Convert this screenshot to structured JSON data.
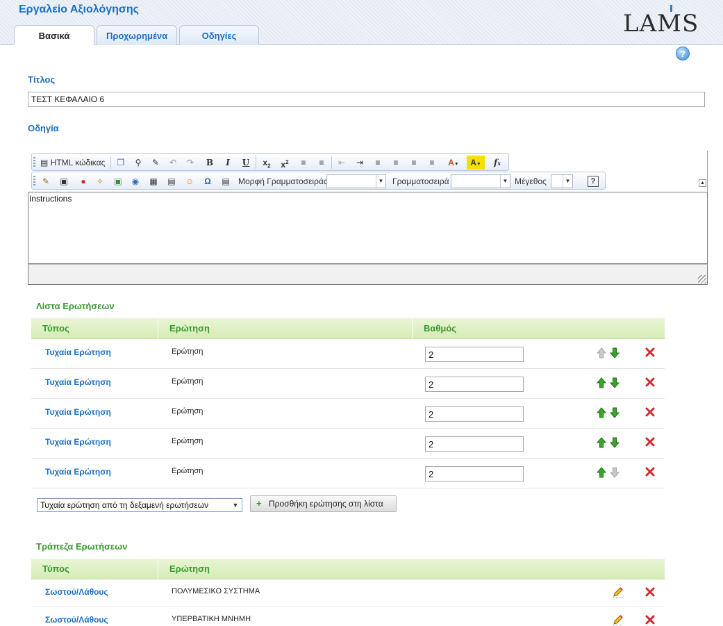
{
  "app": {
    "title": "Εργαλείο Αξιολόγησης",
    "logo": "LAMS"
  },
  "tabs": [
    {
      "label": "Βασικά",
      "active": true
    },
    {
      "label": "Προχωρημένα",
      "active": false
    },
    {
      "label": "Οδηγίες",
      "active": false
    }
  ],
  "help_icon": "?",
  "form": {
    "title_label": "Τίτλος",
    "title_value": "ΤΕΣΤ ΚΕΦΑΛΑΙΟ 6",
    "instructions_label": "Οδηγία",
    "instructions_value": "Instructions"
  },
  "editor_toolbar": {
    "html_source": "HTML κώδικας",
    "format_label": "Μορφή Γραμματοσειράς",
    "font_label": "Γραμματοσειρά",
    "size_label": "Μέγεθος",
    "help": "?"
  },
  "question_list": {
    "heading": "Λίστα Ερωτήσεων",
    "columns": [
      "Τύπος",
      "Ερώτηση",
      "Βαθμός"
    ],
    "rows": [
      {
        "type": "Τυχαία Ερώτηση",
        "question": "Ερώτηση",
        "grade": "2",
        "up_enabled": false,
        "down_enabled": true
      },
      {
        "type": "Τυχαία Ερώτηση",
        "question": "Ερώτηση",
        "grade": "2",
        "up_enabled": true,
        "down_enabled": true
      },
      {
        "type": "Τυχαία Ερώτηση",
        "question": "Ερώτηση",
        "grade": "2",
        "up_enabled": true,
        "down_enabled": true
      },
      {
        "type": "Τυχαία Ερώτηση",
        "question": "Ερώτηση",
        "grade": "2",
        "up_enabled": true,
        "down_enabled": true
      },
      {
        "type": "Τυχαία Ερώτηση",
        "question": "Ερώτηση",
        "grade": "2",
        "up_enabled": true,
        "down_enabled": false
      }
    ],
    "selector_value": "Τυχαία ερώτηση από τη δεξαμενή ερωτήσεων",
    "add_button": "Προσθήκη ερώτησης στη λίστα"
  },
  "question_bank": {
    "heading": "Τράπεζα Ερωτήσεων",
    "columns": [
      "Τύπος",
      "Ερώτηση"
    ],
    "rows": [
      {
        "type": "Σωστού/Λάθους",
        "question": "ΠΟΛΥΜΕΣΙΚΟ ΣΥΣΤΗΜΑ"
      },
      {
        "type": "Σωστού/Λάθους",
        "question": "ΥΠΕΡΒΑΤΙΚΗ ΜΝΗΜΗ"
      }
    ]
  },
  "colors": {
    "accent_blue": "#1a6fc2",
    "accent_green": "#3a9b2e",
    "delete_red": "#cc2222"
  }
}
